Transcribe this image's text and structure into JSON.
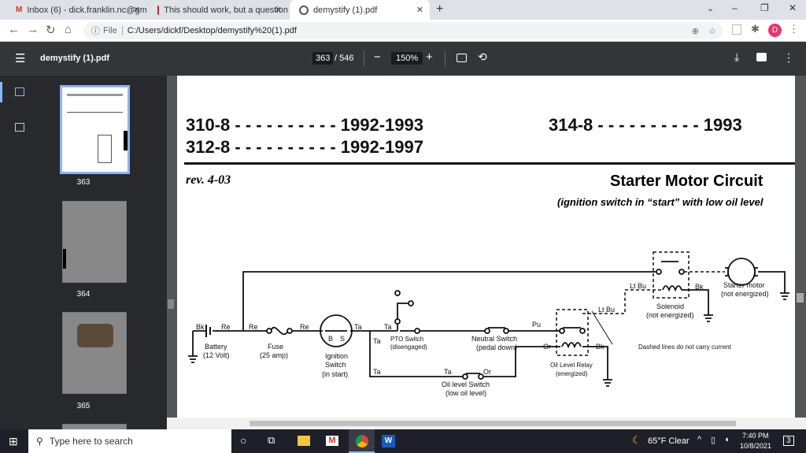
{
  "browser": {
    "tabs": [
      {
        "label": "Inbox (6) - dick.franklin.nc@gmai",
        "icon": "gmail-icon"
      },
      {
        "label": "This should work, but a question",
        "icon": "site-icon"
      },
      {
        "label": "demystify (1).pdf",
        "icon": "globe-icon"
      }
    ],
    "new_tab": "+",
    "address_prefix": "File",
    "url": "C:/Users/dickf/Desktop/demystify%20(1).pdf",
    "profile_initial": "D"
  },
  "pdf": {
    "filename": "demystify (1).pdf",
    "current_page": "363",
    "total_pages": "/ 546",
    "zoom": "150%"
  },
  "thumbnails": [
    {
      "page": "363",
      "selected": true
    },
    {
      "page": "364"
    },
    {
      "page": "365"
    }
  ],
  "document": {
    "line1_model": "310-8 - - - - - - - - - - 1992-1993",
    "line1_right": "314-8 - - - - - - - - - - 1993",
    "line2_model": "312-8 - - - - - - - - - - 1992-1997",
    "rev": "rev. 4-03",
    "title": "Starter Motor Circuit",
    "subtitle": "(ignition switch in “start” with low oil level",
    "labels": {
      "bk1": "Bk",
      "re1": "Re",
      "re2": "Re",
      "re3": "Re",
      "battery": "Battery",
      "battery_sub": "(12 Volt)",
      "fuse": "Fuse",
      "fuse_sub": "(25 amp)",
      "ign": "Ignition",
      "ign2": "Switch",
      "ign_sub": "(in start)",
      "b": "B",
      "s": "S",
      "ta1": "Ta",
      "ta2": "Ta",
      "ta3": "Ta",
      "ta4": "Ta",
      "ta5": "Ta",
      "pto": "PTO Switch",
      "pto_sub": "(disengaged)",
      "neutral": "Neutral Switch",
      "neutral_sub": "(pedal down)",
      "pu": "Pu",
      "or1": "Or",
      "or2": "Or",
      "bk2": "Bk",
      "bk3": "Bk",
      "ltbu1": "Lt Bu",
      "ltbu2": "Lt Bu",
      "oilsw": "Oil level Switch",
      "oilsw_sub": "(low oil level)",
      "relay": "Oil Level Relay",
      "relay_sub": "(energized)",
      "solenoid": "Solenoid",
      "solenoid_sub": "(not energized)",
      "motor": "Starter motor",
      "motor_sub": "(not energized)",
      "dashed_note": "Dashed lines do not carry current"
    }
  },
  "taskbar": {
    "search_placeholder": "Type here to search",
    "weather": "65°F  Clear",
    "time": "7:40 PM",
    "date": "10/8/2021",
    "notifications": "3"
  }
}
